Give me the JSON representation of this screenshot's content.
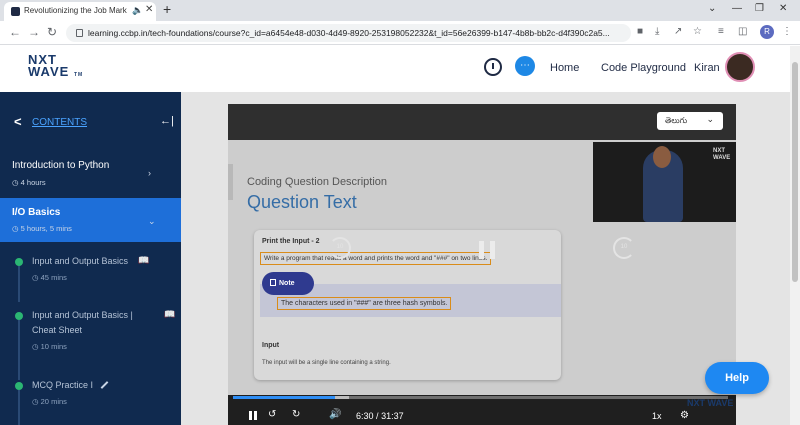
{
  "browser": {
    "tab_title": "Revolutionizing the Job Mark",
    "new_tab": "+",
    "url": "learning.ccbp.in/tech-foundations/course?c_id=a6454e48-d030-4d49-8920-253198052232&t_id=56e26399-b147-4b8b-bb2c-d4f390c2a5...",
    "profile_initial": "R",
    "win_min": "—",
    "win_restore": "❐",
    "win_close": "✕"
  },
  "header": {
    "logo_line1": "NXT",
    "logo_line2": "WAVE",
    "logo_tm": "TM",
    "home": "Home",
    "code_playground": "Code Playground",
    "user_name": "Kiran"
  },
  "sidebar": {
    "contents_label": "CONTENTS",
    "sections": [
      {
        "title": "Introduction to Python",
        "meta": "4 hours",
        "active": false
      },
      {
        "title": "I/O Basics",
        "meta": "5 hours, 5 mins",
        "active": true
      }
    ],
    "lessons": [
      {
        "title": "Input and Output Basics",
        "meta": "45 mins",
        "icon": "book-icon"
      },
      {
        "title_line1": "Input and Output Basics |",
        "title_line2": "Cheat Sheet",
        "meta": "10 mins",
        "icon": "book-icon"
      },
      {
        "title": "MCQ Practice I",
        "meta": "20 mins",
        "icon": "pencil-icon"
      }
    ]
  },
  "player": {
    "language": "తెలుగు",
    "slide_subtitle": "Coding Question Description",
    "slide_title": "Question Text",
    "card_title": "Print the Input - 2",
    "card_highlight": "Write a program that reads a word and prints the word and \"###\" on two lines.",
    "note_label": "Note",
    "note_text": "The characters used in \"###\" are three hash symbols.",
    "input_label": "Input",
    "input_text": "The input will be a single line containing a string.",
    "rewind_seconds": "10",
    "forward_seconds": "10",
    "current_time": "6:30",
    "total_time": "31:37",
    "time_separator": "/",
    "speed": "1x",
    "progress_fraction": 0.206,
    "buffered_fraction": 0.235,
    "watermark": "NXT WAVE"
  },
  "help_label": "Help"
}
